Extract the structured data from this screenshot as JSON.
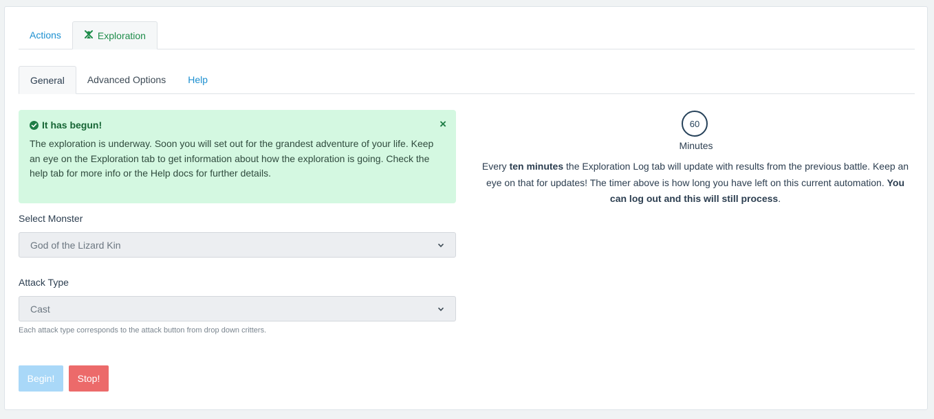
{
  "tabs": {
    "actions": "Actions",
    "exploration": "Exploration"
  },
  "subtabs": {
    "general": "General",
    "advanced": "Advanced Options",
    "help": "Help"
  },
  "alert": {
    "title": "It has begun!",
    "close": "×",
    "body": "The exploration is underway. Soon you will set out for the grandest adventure of your life. Keep an eye on the Exploration tab to get information about how the exploration is going. Check the help tab for more info or the Help docs for further details."
  },
  "monster": {
    "label": "Select Monster",
    "value": "God of the Lizard Kin"
  },
  "attack": {
    "label": "Attack Type",
    "value": "Cast",
    "help": "Each attack type corresponds to the attack button from drop down critters."
  },
  "buttons": {
    "begin": "Begin!",
    "stop": "Stop!"
  },
  "timer": {
    "value": "60",
    "unit": "Minutes"
  },
  "description": {
    "p1": "Every ",
    "b1": "ten minutes",
    "p2": " the Exploration Log tab will update with results from the previous battle. Keep an eye on that for updates! The timer above is how long you have left on this current automation. ",
    "b2": "You can log out and this will still process",
    "p3": "."
  },
  "colors": {
    "accent": "#1b8fd0",
    "success": "#1e8c4a",
    "danger": "#ec6a6a"
  }
}
